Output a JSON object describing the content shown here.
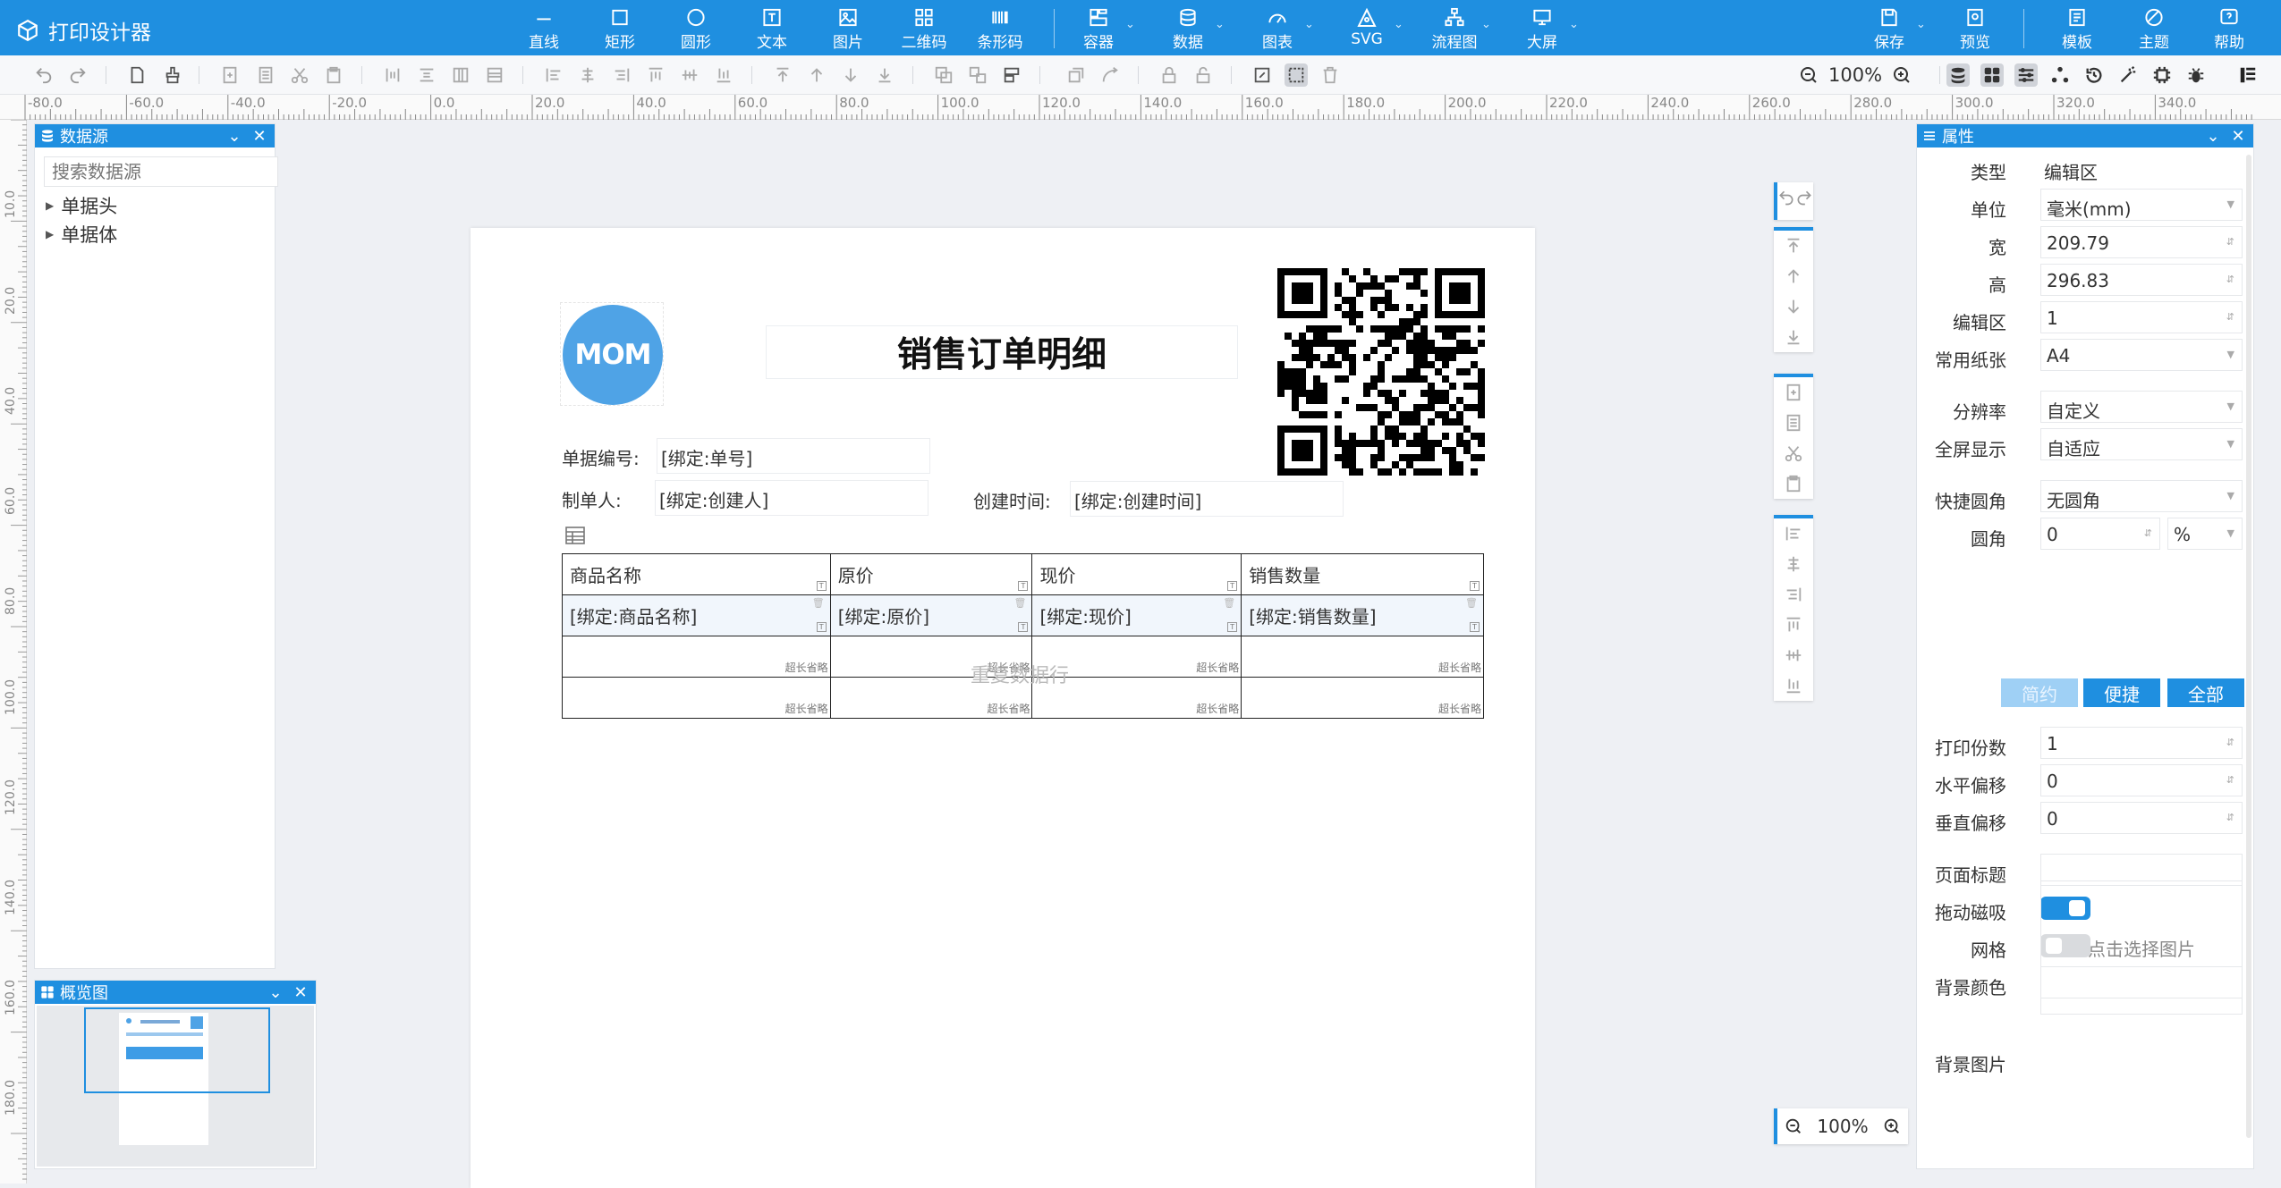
{
  "app": {
    "title": "打印设计器"
  },
  "toolbar_top": {
    "items": [
      {
        "label": "直线",
        "icon": "line-icon"
      },
      {
        "label": "矩形",
        "icon": "rect-icon"
      },
      {
        "label": "圆形",
        "icon": "circle-icon"
      },
      {
        "label": "文本",
        "icon": "text-icon"
      },
      {
        "label": "图片",
        "icon": "image-icon"
      },
      {
        "label": "二维码",
        "icon": "qrcode-icon"
      },
      {
        "label": "条形码",
        "icon": "barcode-icon"
      },
      {
        "label": "容器",
        "icon": "container-icon"
      },
      {
        "label": "数据",
        "icon": "database-icon"
      },
      {
        "label": "图表",
        "icon": "chart-icon"
      },
      {
        "label": "SVG",
        "icon": "svg-icon"
      },
      {
        "label": "流程图",
        "icon": "flowchart-icon"
      },
      {
        "label": "大屏",
        "icon": "screen-icon"
      }
    ],
    "right_items": [
      {
        "label": "保存",
        "icon": "save-icon"
      },
      {
        "label": "预览",
        "icon": "preview-icon"
      },
      {
        "label": "模板",
        "icon": "template-icon"
      },
      {
        "label": "主题",
        "icon": "theme-icon"
      },
      {
        "label": "帮助",
        "icon": "help-icon"
      }
    ]
  },
  "zoom": {
    "top": "100%",
    "bottom": "100%"
  },
  "ruler": {
    "h_ticks": [
      "-80.0",
      "-60.0",
      "-40.0",
      "-20.0",
      "0.0",
      "20.0",
      "40.0",
      "60.0",
      "80.0",
      "100.0",
      "120.0",
      "140.0",
      "160.0",
      "180.0",
      "200.0",
      "220.0",
      "240.0",
      "260.0",
      "280.0",
      "300.0",
      "320.0",
      "340.0"
    ],
    "v_ticks": [
      "10.0",
      "20.0",
      "40.0",
      "60.0",
      "80.0",
      "100.0",
      "120.0",
      "140.0",
      "160.0",
      "180.0"
    ]
  },
  "datasource_panel": {
    "title": "数据源",
    "search_placeholder": "搜索数据源",
    "items": [
      {
        "label": "单据头"
      },
      {
        "label": "单据体"
      }
    ]
  },
  "overview_panel": {
    "title": "概览图"
  },
  "page": {
    "logo_text": "MOM",
    "title": "销售订单明细",
    "fields": {
      "doc_no_label": "单据编号:",
      "doc_no_value": "[绑定:单号]",
      "creator_label": "制单人:",
      "creator_value": "[绑定:创建人]",
      "created_label": "创建时间:",
      "created_value": "[绑定:创建时间]"
    },
    "table": {
      "headers": [
        "商品名称",
        "原价",
        "现价",
        "销售数量"
      ],
      "bind_row": [
        "[绑定:商品名称]",
        "[绑定:原价]",
        "[绑定:现价]",
        "[绑定:销售数量]"
      ],
      "overflow_tag": "超长省略"
    },
    "watermark": "重复数据行"
  },
  "properties_panel": {
    "title": "属性",
    "type_label": "类型",
    "type_value": "编辑区",
    "unit_label": "单位",
    "unit_value": "毫米(mm)",
    "width_label": "宽",
    "width_value": "209.79",
    "height_label": "高",
    "height_value": "296.83",
    "edit_area_label": "编辑区",
    "edit_area_value": "1",
    "paper_label": "常用纸张",
    "paper_value": "A4",
    "resolution_label": "分辨率",
    "resolution_value": "自定义",
    "fullscreen_label": "全屏显示",
    "fullscreen_value": "自适应",
    "quick_radius_label": "快捷圆角",
    "quick_radius_value": "无圆角",
    "radius_label": "圆角",
    "radius_value": "0",
    "radius_unit": "%",
    "mode_buttons": [
      "简约",
      "便捷",
      "全部"
    ],
    "copies_label": "打印份数",
    "copies_value": "1",
    "h_offset_label": "水平偏移",
    "h_offset_value": "0",
    "v_offset_label": "垂直偏移",
    "v_offset_value": "0",
    "page_title_label": "页面标题",
    "page_title_value": "",
    "drag_snap_label": "拖动磁吸",
    "drag_snap_on": true,
    "grid_label": "网格",
    "grid_on": false,
    "bg_color_label": "背景颜色",
    "bg_image_label": "背景图片",
    "bg_image_hint": "点击选择图片"
  },
  "colors": {
    "accent": "#1f8fe0",
    "logo": "#4fa3e6"
  }
}
